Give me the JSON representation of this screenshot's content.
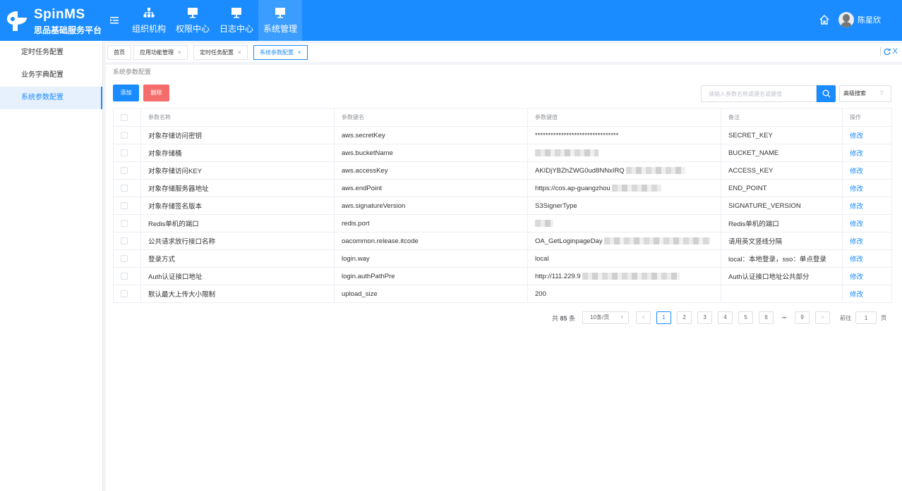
{
  "app": {
    "title": "SpinMS",
    "subtitle": "思品基础服务平台"
  },
  "topnav": [
    {
      "label": "组织机构",
      "icon": "org-chart-icon"
    },
    {
      "label": "权限中心",
      "icon": "monitor-icon"
    },
    {
      "label": "日志中心",
      "icon": "monitor-icon"
    },
    {
      "label": "系统管理",
      "icon": "monitor-icon",
      "active": true
    }
  ],
  "user": {
    "name": "陈星欣"
  },
  "sidebar": {
    "items": [
      {
        "label": "定时任务配置"
      },
      {
        "label": "业务字典配置"
      },
      {
        "label": "系统参数配置",
        "active": true
      }
    ]
  },
  "tabs": [
    {
      "label": "首页"
    },
    {
      "label": "应用功能管理",
      "close": "×"
    },
    {
      "label": "定时任务配置",
      "close": "×"
    },
    {
      "label": "系统参数配置",
      "close": "×",
      "active": true
    }
  ],
  "tab_tools": {
    "close": "X"
  },
  "page": {
    "title": "系统参数配置"
  },
  "toolbar": {
    "add_label": "添加",
    "delete_label": "删除",
    "search_placeholder": "请输入参数名称或键名或键值",
    "advanced_label": "高级搜索"
  },
  "table": {
    "headers": [
      "参数名称",
      "参数键名",
      "参数键值",
      "备注",
      "操作"
    ],
    "edit_label": "修改",
    "rows": [
      {
        "name": "对象存储访问密钥",
        "key": "aws.secretKey",
        "value": "********************************",
        "blur": 0,
        "note": "SECRET_KEY"
      },
      {
        "name": "对象存储桶",
        "key": "aws.bucketName",
        "value": "",
        "blur": 90,
        "note": "BUCKET_NAME"
      },
      {
        "name": "对象存储访问KEY",
        "key": "aws.accessKey",
        "value": "AKIDjYBZhZWG0ud8NNxIRQ",
        "blur": 84,
        "note": "ACCESS_KEY"
      },
      {
        "name": "对象存储服务器地址",
        "key": "aws.endPoint",
        "value": "https://cos.ap-guangzhou",
        "blur": 70,
        "note": "END_POINT"
      },
      {
        "name": "对象存储签名版本",
        "key": "aws.signatureVersion",
        "value": "S3SignerType",
        "blur": 0,
        "note": "SIGNATURE_VERSION"
      },
      {
        "name": "Redis单机的端口",
        "key": "redis.port",
        "value": "",
        "blur": 26,
        "note": "Redis单机的端口"
      },
      {
        "name": "公共请求放行接口名称",
        "key": "oacommon.release.itcode",
        "value": "OA_GetLoginpageDay",
        "blur": 150,
        "note": "请用英文竖线分隔"
      },
      {
        "name": "登录方式",
        "key": "login.way",
        "value": "local",
        "blur": 0,
        "note": "local：本地登录，sso：单点登录"
      },
      {
        "name": "Auth认证接口地址",
        "key": "login.authPathPre",
        "value": "http://111.229.9",
        "blur": 138,
        "note": "Auth认证接口地址公共部分"
      },
      {
        "name": "默认最大上传大小限制",
        "key": "upload_size",
        "value": "200",
        "blur": 0,
        "note": ""
      }
    ]
  },
  "pagination": {
    "total_prefix": "共",
    "total": "85",
    "total_suffix": "条",
    "page_size": "10条/页",
    "prev": "<",
    "next": ">",
    "pages": [
      "1",
      "2",
      "3",
      "4",
      "5",
      "6"
    ],
    "ellipsis": "···",
    "last_page": "9",
    "current": "1",
    "goto_prefix": "前往",
    "goto_value": "1",
    "goto_suffix": "页"
  },
  "colors": {
    "primary": "#1a8cff",
    "danger": "#f56c6c"
  }
}
